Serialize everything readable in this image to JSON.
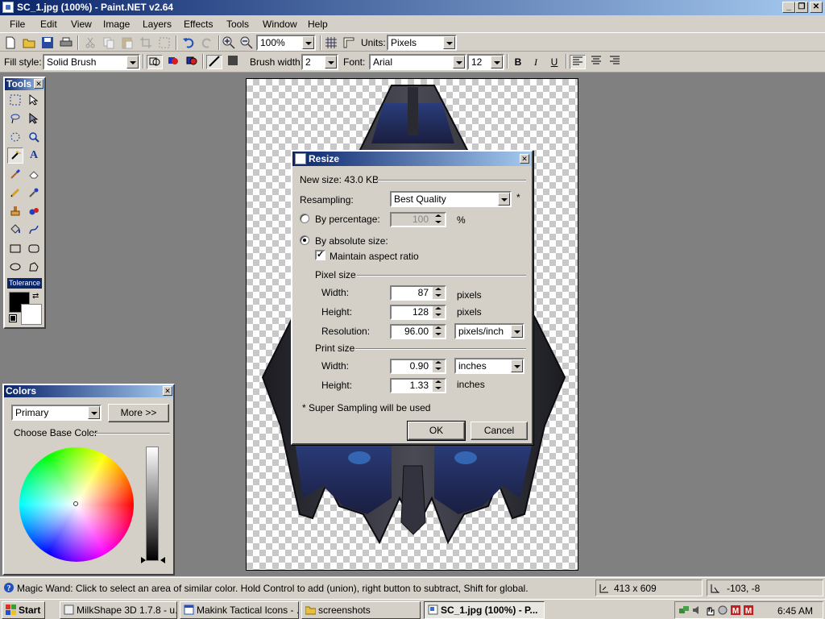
{
  "window": {
    "title": "SC_1.jpg (100%) - Paint.NET v2.64"
  },
  "menu": [
    "File",
    "Edit",
    "View",
    "Image",
    "Layers",
    "Effects",
    "Tools",
    "Window",
    "Help"
  ],
  "toolbar": {
    "zoom": "100%",
    "units_label": "Units:",
    "units_value": "Pixels",
    "fill_style_label": "Fill style:",
    "fill_style_value": "Solid Brush",
    "brush_width_label": "Brush width:",
    "brush_width_value": "2",
    "font_label": "Font:",
    "font_value": "Arial",
    "font_size_value": "12",
    "bold": "B",
    "italic": "I",
    "underline": "U"
  },
  "tools_window": {
    "title": "Tools",
    "tolerance_label": "Tolerance"
  },
  "colors_window": {
    "title": "Colors",
    "mode": "Primary",
    "more_button": "More >>",
    "choose_label": "Choose Base Color",
    "primary_color": "#000000",
    "secondary_color": "#ffffff"
  },
  "resize_dialog": {
    "title": "Resize",
    "new_size": "New size: 43.0 KB",
    "resampling_label": "Resampling:",
    "resampling_value": "Best Quality",
    "asterisk": "*",
    "by_percentage_label": "By percentage:",
    "percentage_value": "100",
    "percent_sign": "%",
    "by_absolute_label": "By absolute size:",
    "maintain_aspect_label": "Maintain aspect ratio",
    "pixel_size_label": "Pixel size",
    "width_label": "Width:",
    "width_value": "87",
    "width_unit": "pixels",
    "height_label": "Height:",
    "height_value": "128",
    "height_unit": "pixels",
    "resolution_label": "Resolution:",
    "resolution_value": "96.00",
    "resolution_unit": "pixels/inch",
    "print_size_label": "Print size",
    "print_width_label": "Width:",
    "print_width_value": "0.90",
    "print_width_unit": "inches",
    "print_height_label": "Height:",
    "print_height_value": "1.33",
    "print_height_unit": "inches",
    "footnote": "* Super Sampling will be used",
    "ok": "OK",
    "cancel": "Cancel"
  },
  "status": {
    "hint": "Magic Wand: Click to select an area of similar color. Hold Control to add (union), right button to subtract, Shift for global.",
    "image_size": "413 x 609",
    "cursor_pos": "-103, -8"
  },
  "taskbar": {
    "start": "Start",
    "tasks": [
      "MilkShape 3D 1.7.8 - u...",
      "Makink Tactical Icons - ...",
      "screenshots",
      "SC_1.jpg (100%) - P..."
    ],
    "clock": "6:45 AM"
  }
}
